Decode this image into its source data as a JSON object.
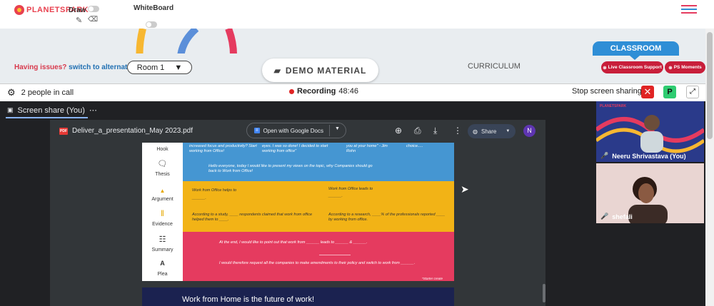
{
  "app": {
    "logo": "PLANETSPARK",
    "draw_label": "Draw",
    "whiteboard_label": "WhiteBoard"
  },
  "bar2": {
    "issue_text": "Having issues?",
    "issue_link": "switch to alternate room",
    "room": "Room 1",
    "demo_material": "DEMO MATERIAL",
    "curriculum": "CURRICULUM",
    "classroom": "CLASSROOM",
    "live_support": "Live Classroom Support",
    "ps_moments": "PS Moments"
  },
  "call": {
    "people": "2 people in call",
    "recording_label": "Recording",
    "recording_time": "48:46",
    "stop_share": "Stop screen sharing",
    "p_badge": "P"
  },
  "screen": {
    "tab_label": "Screen share (You)"
  },
  "pdf": {
    "filename": "Deliver_a_presentation_May 2023.pdf",
    "open_with": "Open with Google Docs",
    "share": "Share",
    "avatar": "N"
  },
  "slide": {
    "labels": [
      "Hook",
      "Thesis",
      "Argument",
      "Evidence",
      "Summary",
      "Plea"
    ],
    "hook_t1": "increased focus and productivity? Start working from Office!",
    "hook_t2": "eyes. I was so done! I decided to start working from office\"",
    "hook_t3": "you at your home\" - Jim Rohn",
    "hook_t4": "choice.....",
    "thesis": "Hello everyone, today I would like to present my views on the topic, why Companies should go back to Work from Office!",
    "arg1": "Work from Office helps to",
    "arg1b": "______.",
    "arg2": "Work from Office leads to",
    "arg2b": "______.",
    "ev1": "According to a study, ____ respondents claimed that work from office helped them to ____.",
    "ev2": "According to a research, ____% of the professionals reported ____ by working from office.",
    "sum": "At the end, I would like to point out that work from ______ leads to ______ & ______.",
    "plea": "I would therefore request all the companies to make amendments to their policy and switch to work from ______.",
    "starter": "*Starter create",
    "next_title": "Work from Home is the future of work!"
  },
  "participants": [
    {
      "name": "Neeru Shrivastava (You)"
    },
    {
      "name": "shefali"
    }
  ],
  "colors": {
    "hook": "#4596d2",
    "argument": "#f2b316",
    "summary": "#e53b5f",
    "recording": "#e02424"
  }
}
